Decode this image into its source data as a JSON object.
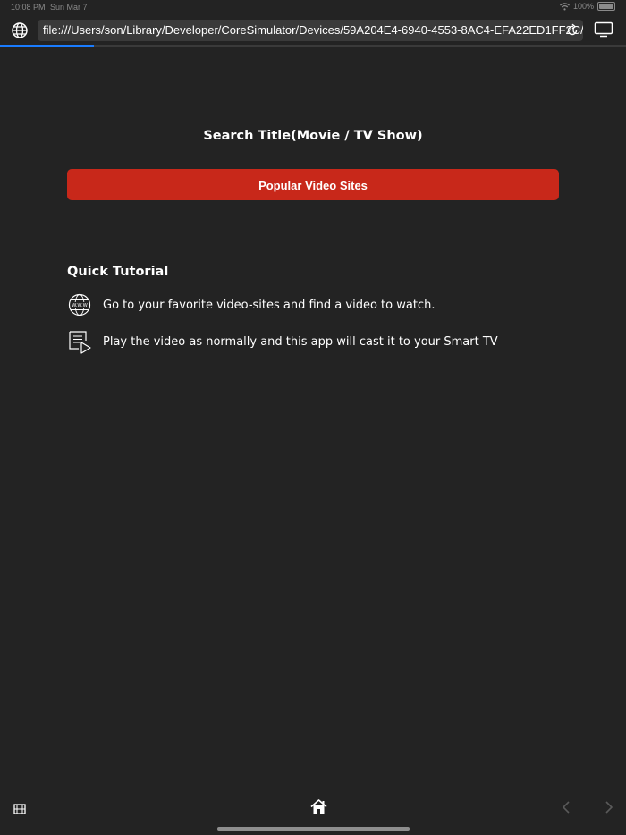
{
  "status_bar": {
    "time": "10:08 PM",
    "date": "Sun Mar 7",
    "battery": "100%"
  },
  "toolbar": {
    "url": "file:///Users/son/Library/Developer/CoreSimulator/Devices/59A204E4-6940-4553-8AC4-EFA22ED1FF2C/data/C...",
    "load_progress": 0.15
  },
  "main": {
    "search_title": "Search Title(Movie / TV Show)",
    "popular_button_label": "Popular Video Sites"
  },
  "tutorial": {
    "heading": "Quick Tutorial",
    "steps": [
      {
        "icon": "www-globe-icon",
        "text": "Go to your favorite video-sites and find a video to watch."
      },
      {
        "icon": "playlist-play-icon",
        "text": "Play the video as normally and this app will cast it to your Smart TV"
      }
    ]
  },
  "bottom_bar": {
    "icons": [
      "film-icon",
      "home-icon",
      "back-chevron-icon",
      "forward-chevron-icon"
    ]
  },
  "colors": {
    "background": "#232323",
    "accent_red": "#c8281a",
    "progress_blue": "#1a7cff"
  }
}
